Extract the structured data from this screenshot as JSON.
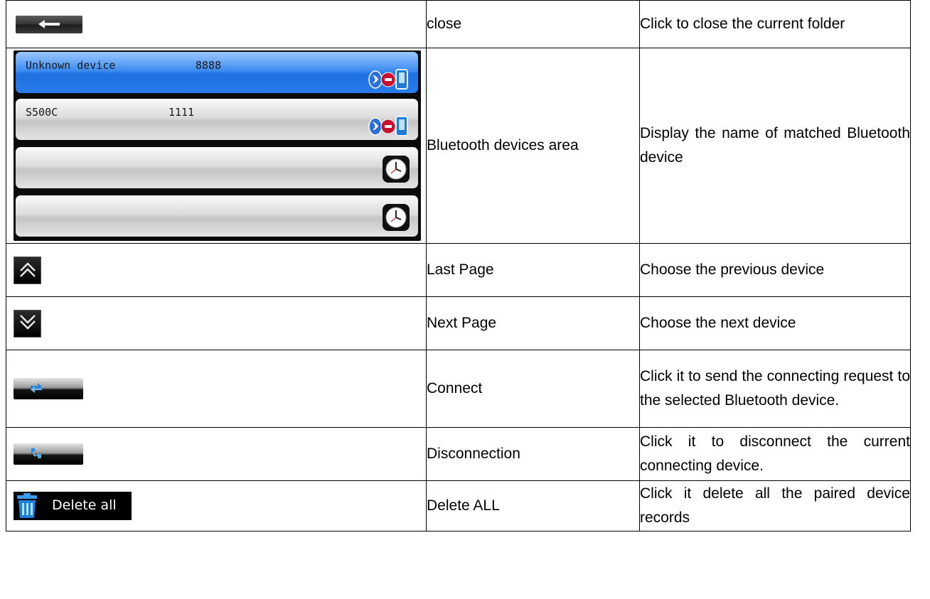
{
  "rows": [
    {
      "icon": "back-arrow-icon",
      "name": "close",
      "desc": "Click to close the current folder"
    },
    {
      "icon": "bluetooth-devices-panel",
      "name": "Bluetooth devices area",
      "desc": "Display the name of matched Bluetooth device"
    },
    {
      "icon": "double-chevron-up-icon",
      "name": "Last Page",
      "desc": "Choose the previous device"
    },
    {
      "icon": "double-chevron-down-icon",
      "name": "Next Page",
      "desc": "Choose the next device"
    },
    {
      "icon": "connect-icon",
      "name": "Connect",
      "desc": "Click it to send the connecting request to the selected Bluetooth device."
    },
    {
      "icon": "disconnect-icon",
      "name": "Disconnection",
      "desc": "Click it to disconnect the current connecting device."
    },
    {
      "icon": "trash-icon",
      "name": "Delete ALL",
      "desc": "Click it delete all the paired device records"
    }
  ],
  "bt_panel": {
    "devices": [
      {
        "name": "Unknown device",
        "code": "8888",
        "selected": true
      },
      {
        "name": "S500C",
        "code": "1111",
        "selected": false
      }
    ],
    "empty_slots": 2
  },
  "delete_all_label": "Delete all",
  "colors": {
    "selected_row": "#2b7ceb",
    "panel_bg": "#0b0b0b",
    "trash_blue": "#2f8fe0"
  }
}
